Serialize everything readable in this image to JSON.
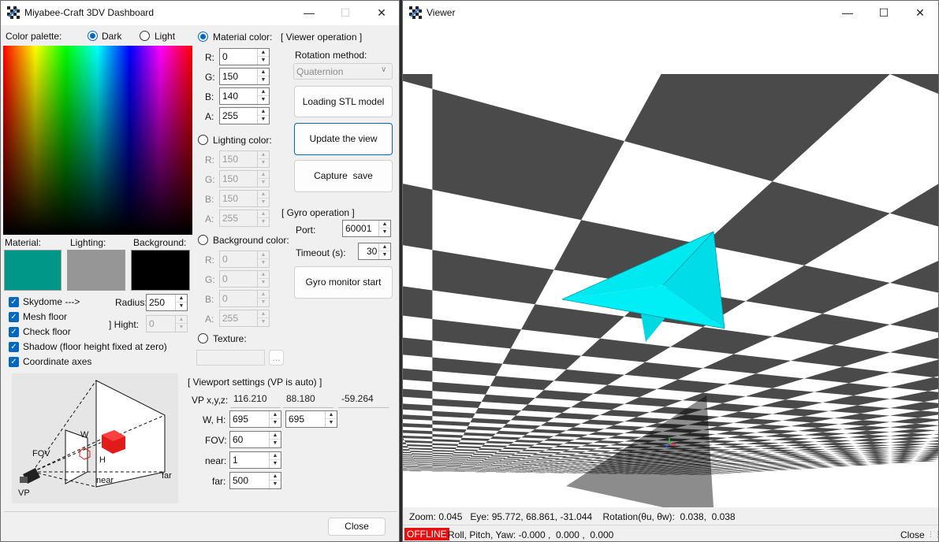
{
  "dashboard": {
    "title": "Miyabee-Craft 3DV Dashboard",
    "color_palette_label": "Color palette:",
    "theme_dark": "Dark",
    "theme_light": "Light",
    "material_color": {
      "label": "Material color:",
      "r": "0",
      "g": "150",
      "b": "140",
      "a": "255"
    },
    "lighting_color": {
      "label": "Lighting color:",
      "r": "150",
      "g": "150",
      "b": "150",
      "a": "255"
    },
    "background_color": {
      "label": "Background color:",
      "r": "0",
      "g": "0",
      "b": "0",
      "a": "255"
    },
    "channel_labels": {
      "r": "R:",
      "g": "G:",
      "b": "B:",
      "a": "A:"
    },
    "texture_label": "Texture:",
    "texture_browse": "...",
    "swatch_labels": {
      "material": "Material:",
      "lighting": "Lighting:",
      "background": "Background:"
    },
    "swatch_colors": {
      "material": "#009688",
      "lighting": "#969696",
      "background": "#000000"
    },
    "options": {
      "skydome": "Skydome --->",
      "mesh_floor": "Mesh floor",
      "check_floor": "Check floor",
      "shadow": "Shadow (floor height fixed at zero)",
      "coordinate_axes": "Coordinate axes",
      "radius_label": "Radius:",
      "radius_value": "250",
      "hight_label": "] Hight:",
      "hight_value": "0"
    },
    "viewer_operation": {
      "header": "[ Viewer operation ]",
      "rotation_method_label": "Rotation method:",
      "rotation_method_value": "Quaternion",
      "loading_stl_button": "Loading STL model",
      "update_view_button": "Update the view",
      "capture_save_button": "Capture  save"
    },
    "gyro_operation": {
      "header": "[ Gyro operation ]",
      "port_label": "Port:",
      "port_value": "60001",
      "timeout_label": "Timeout (s):",
      "timeout_value": "30",
      "monitor_button": "Gyro monitor start"
    },
    "viewport": {
      "header": "[ Viewport settings (VP is auto) ]",
      "vp_label": "VP x,y,z:",
      "vp_x": "116.210",
      "vp_y": "88.180",
      "vp_z": "-59.264",
      "wh_label": "W, H:",
      "w": "695",
      "h": "695",
      "fov_label": "FOV:",
      "fov": "60",
      "near_label": "near:",
      "near": "1",
      "far_label": "far:",
      "far": "500"
    },
    "diagram_labels": {
      "w": "W",
      "h": "H",
      "fov": "FOV",
      "near": "near",
      "far": "far",
      "vp": "VP"
    },
    "close_button": "Close"
  },
  "viewer": {
    "title": "Viewer",
    "status_line1": "Zoom: 0.045   Eye: 95.772, 68.861, -31.044    Rotation(θu, θw):  0.038,  0.038",
    "offline_badge": "OFFLINE",
    "status_line2": "Roll, Pitch, Yaw: -0.000 ,  0.000 ,  0.000",
    "close_label": "Close",
    "model_color": "#00e5ee",
    "offline_color": "#e81010"
  },
  "icons": {
    "app": "app-logo-icon",
    "minimize": "minimize-icon",
    "maximize": "maximize-icon",
    "close": "close-icon",
    "chevron": "chevron-down-icon",
    "spin_up": "spin-up-icon",
    "spin_down": "spin-down-icon",
    "check": "checkmark-icon",
    "resize_grip": "resize-grip-icon"
  }
}
